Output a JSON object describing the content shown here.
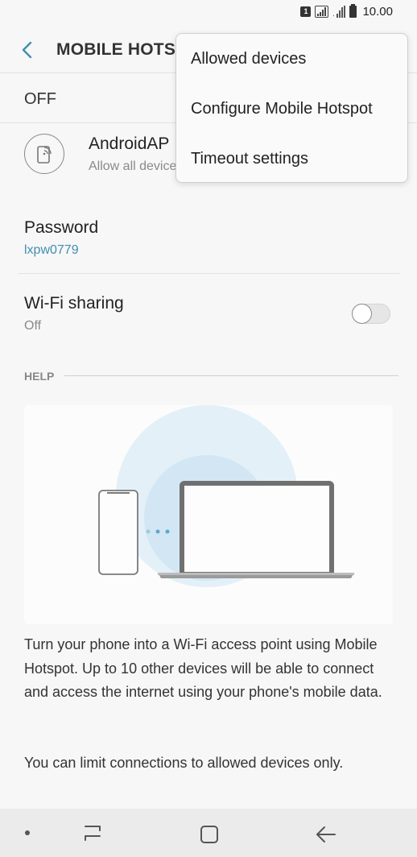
{
  "status_bar": {
    "sim_label": "1",
    "time": "10.00"
  },
  "toolbar": {
    "title": "MOBILE HOTSPOT"
  },
  "master_switch": {
    "label": "OFF"
  },
  "network": {
    "name": "AndroidAP",
    "subtitle": "Allow all devices"
  },
  "password": {
    "title": "Password",
    "value": "lxpw0779"
  },
  "wifi_sharing": {
    "title": "Wi-Fi sharing",
    "subtitle": "Off",
    "enabled": false
  },
  "help": {
    "header": "HELP",
    "description_1": "Turn your phone into a Wi-Fi access point using Mobile Hotspot. Up to 10 other devices will be able to connect and access the internet using your phone's mobile data.",
    "description_2": "You can limit connections to allowed devices only."
  },
  "overflow_menu": {
    "items": [
      {
        "label": "Allowed devices"
      },
      {
        "label": "Configure Mobile Hotspot"
      },
      {
        "label": "Timeout settings"
      }
    ]
  },
  "colors": {
    "accent": "#3f8fb0",
    "background": "#f7f7f7",
    "illustration_circle": "#dcedf6"
  },
  "icons": {
    "back": "chevron-left-icon",
    "network": "hotspot-phone-icon",
    "nav_recent": "recent-apps-icon",
    "nav_home": "home-icon",
    "nav_back": "back-arrow-icon"
  }
}
